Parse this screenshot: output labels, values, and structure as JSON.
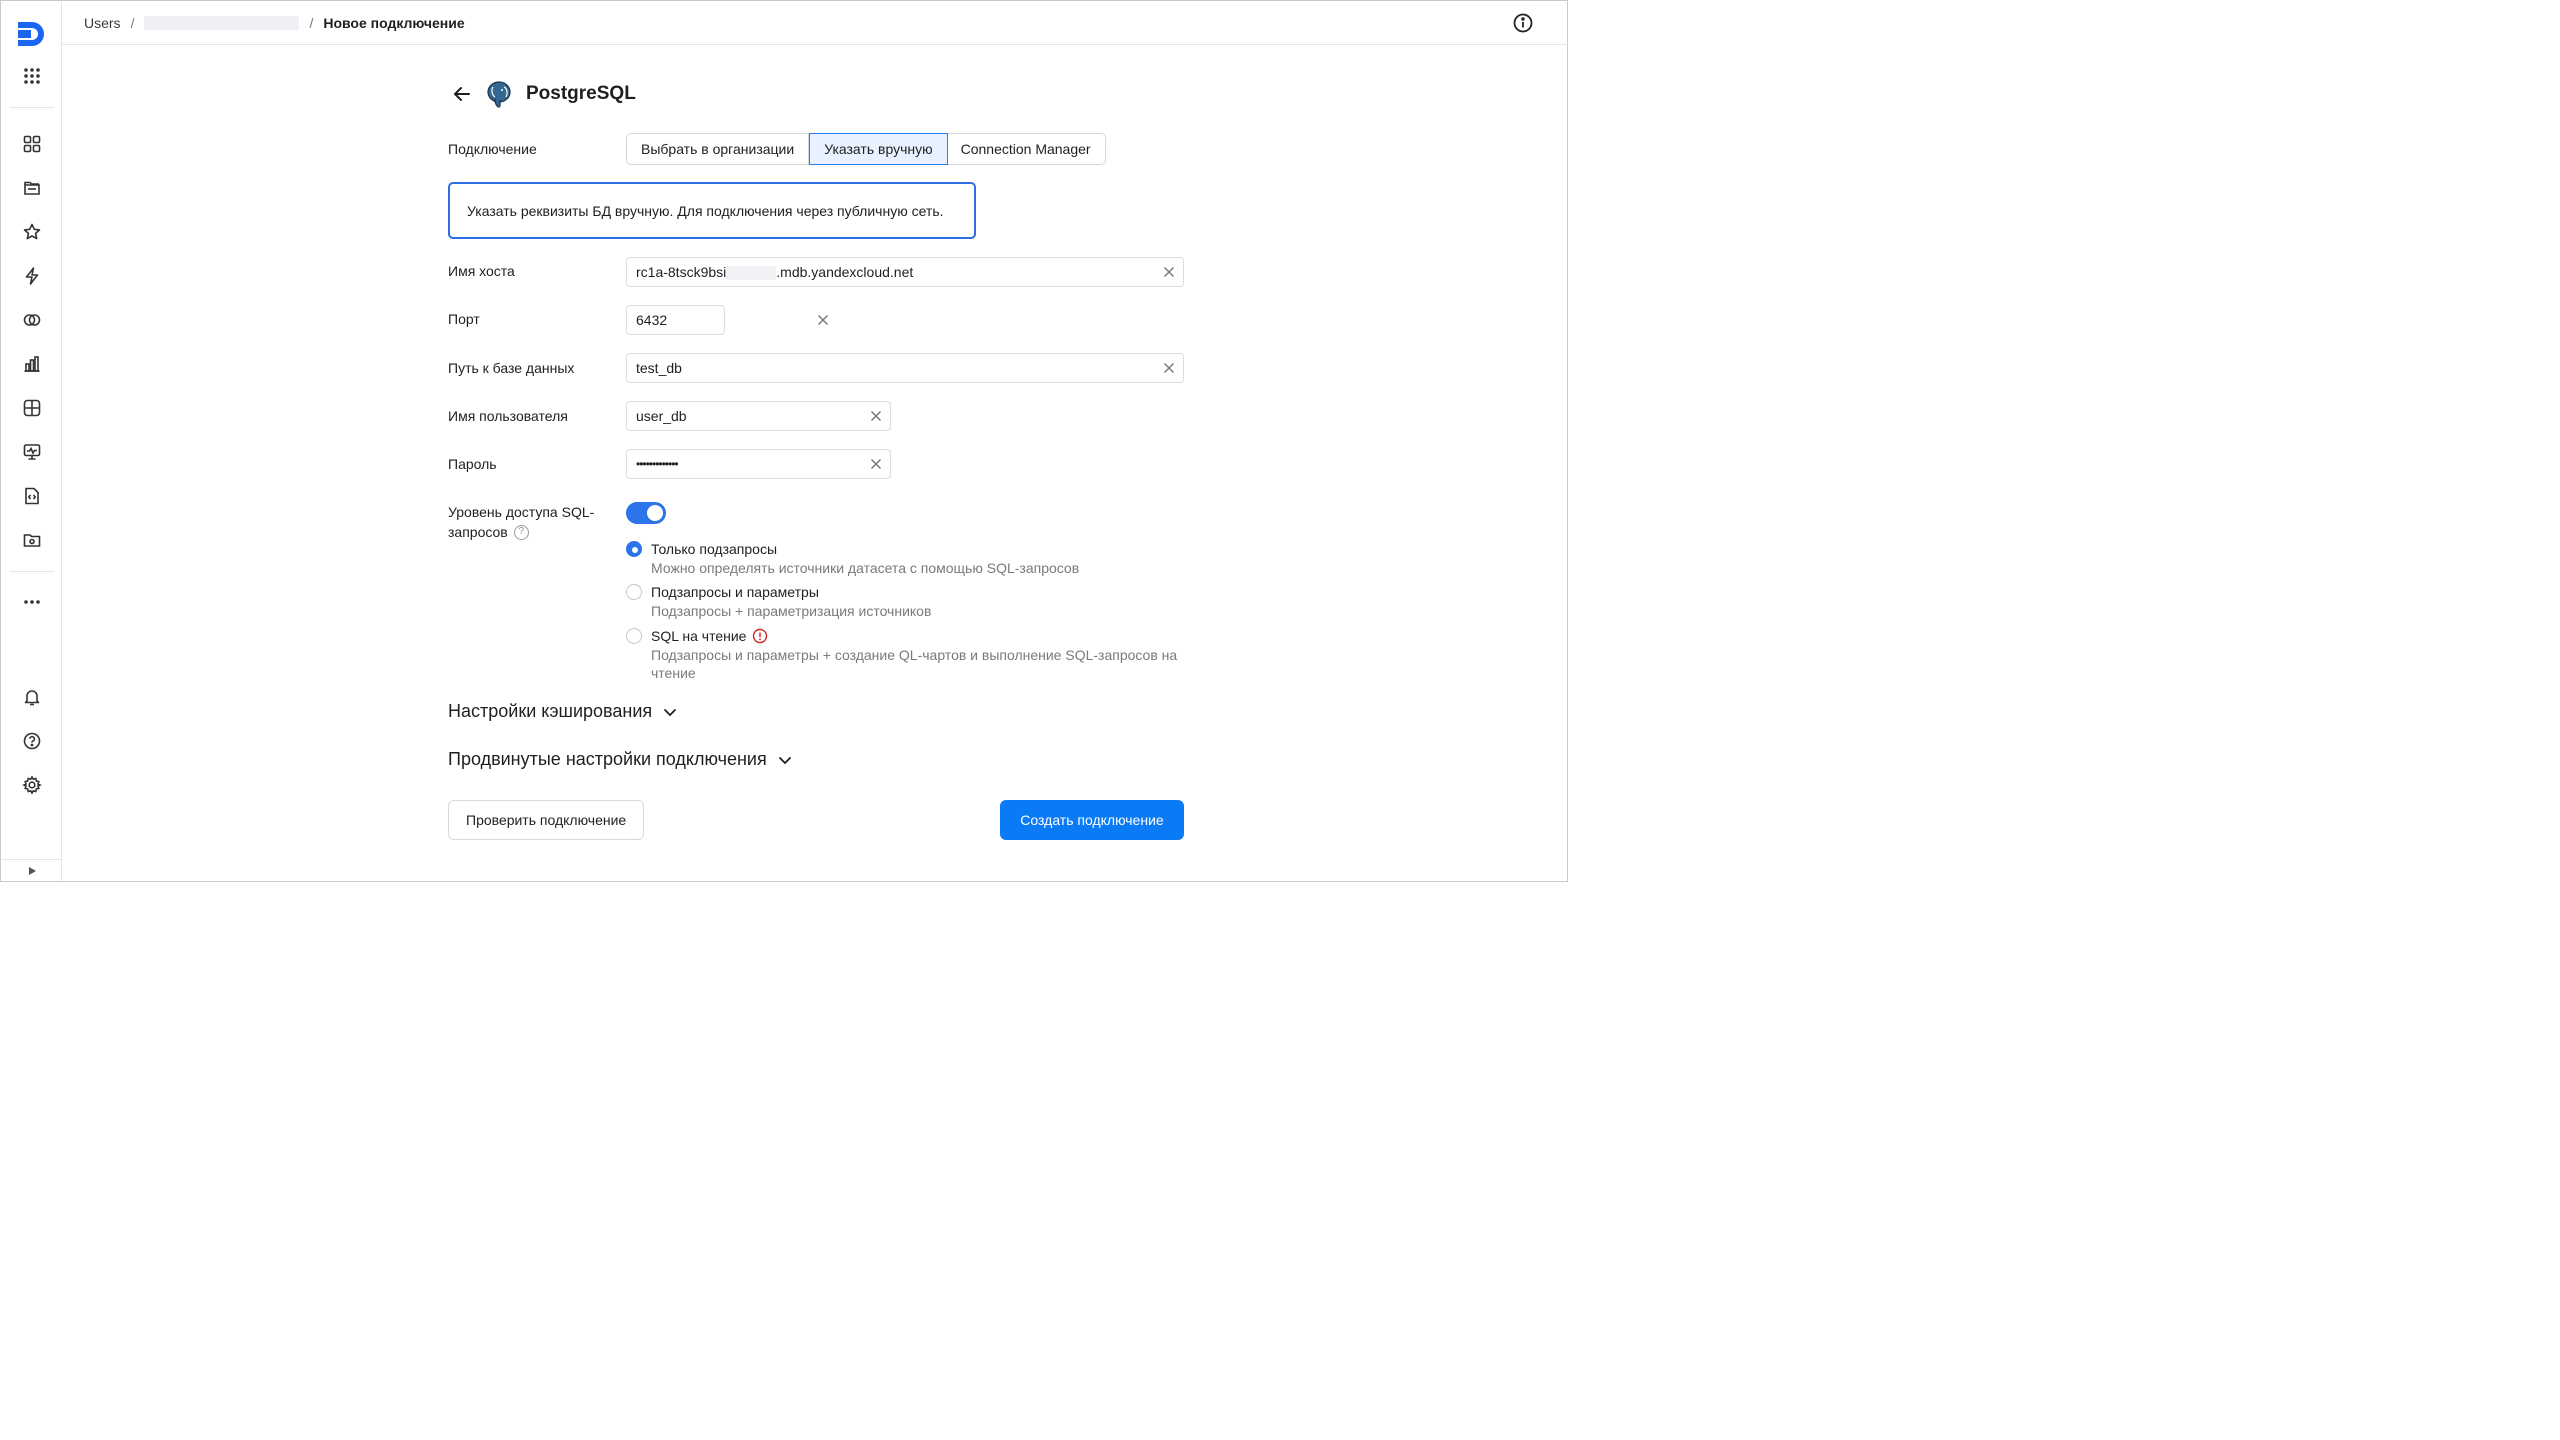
{
  "breadcrumbs": {
    "root": "Users",
    "separator": "/",
    "current": "Новое подключение"
  },
  "page": {
    "title": "PostgreSQL"
  },
  "connection": {
    "label": "Подключение",
    "tabs": [
      {
        "label": "Выбрать в организации",
        "active": false
      },
      {
        "label": "Указать вручную",
        "active": true
      },
      {
        "label": "Connection Manager",
        "active": false
      }
    ],
    "note": "Указать реквизиты БД вручную. Для подключения через публичную сеть."
  },
  "fields": {
    "host": {
      "label": "Имя хоста",
      "value_prefix": "rc1a-8tsck9bsi",
      "value_suffix": ".mdb.yandexcloud.net"
    },
    "port": {
      "label": "Порт",
      "value": "6432"
    },
    "db_path": {
      "label": "Путь к базе данных",
      "value": "test_db"
    },
    "username": {
      "label": "Имя пользователя",
      "value": "user_db"
    },
    "password": {
      "label": "Пароль",
      "value": "•••••••••••••"
    }
  },
  "sql_access": {
    "label": "Уровень доступа SQL-запросов",
    "label_line1": "Уровень доступа SQL-",
    "label_line2": "запросов",
    "enabled": true,
    "options": [
      {
        "title": "Только подзапросы",
        "desc": "Можно определять источники датасета с помощью SQL-запросов",
        "checked": true
      },
      {
        "title": "Подзапросы и параметры",
        "desc": "Подзапросы + параметризация источников",
        "checked": false
      },
      {
        "title": "SQL на чтение",
        "desc": "Подзапросы и параметры + создание QL-чартов и выполнение SQL-запросов на чтение",
        "checked": false,
        "warning": true
      }
    ]
  },
  "sections": {
    "cache": "Настройки кэширования",
    "advanced": "Продвинутые настройки подключения"
  },
  "actions": {
    "check": "Проверить подключение",
    "create": "Создать подключение"
  },
  "colors": {
    "accent": "#0a7af5",
    "active_tab_bg": "#e8f1ff",
    "warning": "#c62828",
    "logo_blue": "#1a66f0"
  }
}
